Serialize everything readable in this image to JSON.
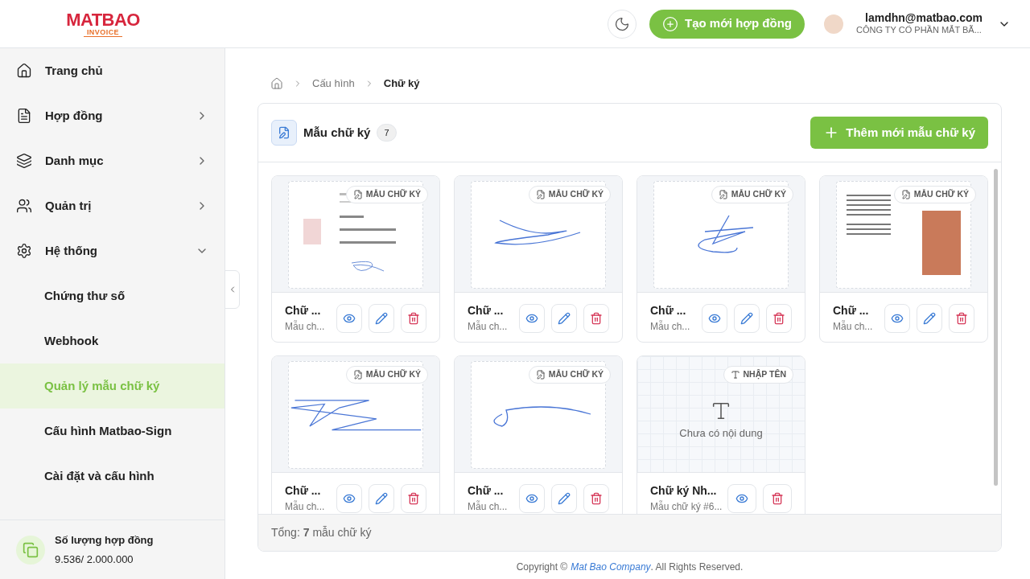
{
  "logo": {
    "name": "MATBAO",
    "sub": "INVOICE"
  },
  "header": {
    "create_button": "Tạo mới hợp đồng",
    "user_email": "lamdhn@matbao.com",
    "user_company": "CÔNG TY CỔ PHẦN MẮT BÃ..."
  },
  "sidebar": {
    "items": [
      {
        "kind": "home",
        "label": "Trang chủ",
        "expandable": false,
        "selected": false
      },
      {
        "kind": "contract",
        "label": "Hợp đồng",
        "expandable": true,
        "expanded": false,
        "selected": false
      },
      {
        "kind": "catalog",
        "label": "Danh mục",
        "expandable": true,
        "expanded": false,
        "selected": false
      },
      {
        "kind": "admin",
        "label": "Quản trị",
        "expandable": true,
        "expanded": false,
        "selected": false
      },
      {
        "kind": "system",
        "label": "Hệ thống",
        "expandable": true,
        "expanded": true,
        "selected": false,
        "children": [
          {
            "label": "Chứng thư số",
            "selected": false
          },
          {
            "label": "Webhook",
            "selected": false
          },
          {
            "label": "Quản lý mẫu chữ ký",
            "selected": true
          },
          {
            "label": "Cấu hình Matbao-Sign",
            "selected": false
          },
          {
            "label": "Cài đặt và cấu hình",
            "selected": false
          }
        ]
      }
    ],
    "quota": {
      "title": "Số lượng hợp đồng",
      "value": "9.536/ 2.000.000"
    }
  },
  "breadcrumb": [
    "Cấu hình",
    "Chữ ký"
  ],
  "panel": {
    "title": "Mẫu chữ ký",
    "count": "7",
    "add_button": "Thêm mới mẫu chữ ký",
    "cards": [
      {
        "kind": "info-sheet",
        "badge": "MẪU CHỮ KÝ",
        "name": "Chữ ...",
        "subtitle": "Mẫu ch...",
        "editable": true
      },
      {
        "kind": "scribble",
        "badge": "MẪU CHỮ KÝ",
        "name": "Chữ ...",
        "subtitle": "Mẫu ch...",
        "editable": true
      },
      {
        "kind": "scribble",
        "badge": "MẪU CHỮ KÝ",
        "name": "Chữ ...",
        "subtitle": "Mẫu ch...",
        "editable": true
      },
      {
        "kind": "photo-sheet",
        "badge": "MẪU CHỮ KÝ",
        "name": "Chữ ...",
        "subtitle": "Mẫu ch...",
        "editable": true
      },
      {
        "kind": "scribble",
        "badge": "MẪU CHỮ KÝ",
        "name": "Chữ ...",
        "subtitle": "Mẫu ch...",
        "editable": true
      },
      {
        "kind": "scribble",
        "badge": "MẪU CHỮ KÝ",
        "name": "Chữ ...",
        "subtitle": "Mẫu ch...",
        "editable": true
      },
      {
        "kind": "typed",
        "badge": "NHẬP TÊN",
        "empty_text": "Chưa có nội dung",
        "name": "Chữ ký Nh...",
        "subtitle": "Mẫu chữ ký #6...",
        "editable": false
      }
    ],
    "total": "Tổng: **7** mẫu chữ ký"
  },
  "copyright": {
    "before": "Copyright ©",
    "link": "Mat Bao Company",
    "after": ". All Rights Reserved."
  }
}
